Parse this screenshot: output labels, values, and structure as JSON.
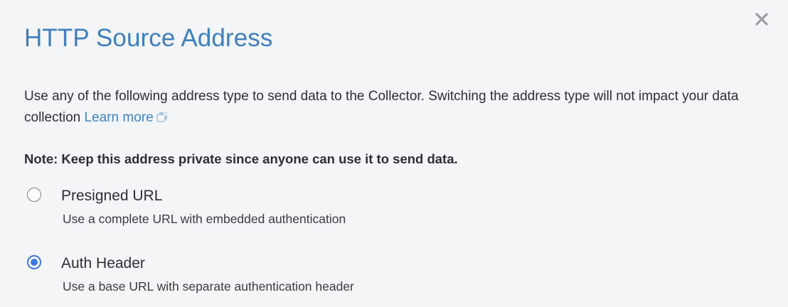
{
  "dialog": {
    "title": "HTTP Source Address",
    "description": "Use any of the following address type to send data to the Collector. Switching the address type will not impact your data collection",
    "learn_more_label": "Learn more",
    "note": "Note: Keep this address private since anyone can use it to send data."
  },
  "options": [
    {
      "label": "Presigned URL",
      "description": "Use a complete URL with embedded authentication",
      "selected": false
    },
    {
      "label": "Auth Header",
      "description": "Use a base URL with separate authentication header",
      "selected": true
    }
  ],
  "icons": {
    "close": "close-icon",
    "external_link": "external-link-icon"
  },
  "colors": {
    "background": "#f4f5f7",
    "title": "#3e7fbf",
    "link": "#3e85c9",
    "radio_selected": "#3b78e7",
    "text": "#2d2f33",
    "close_icon": "#9a9ea3"
  }
}
